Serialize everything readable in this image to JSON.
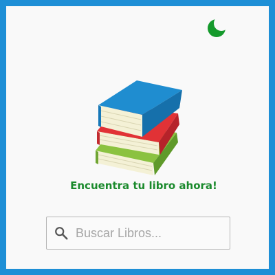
{
  "header": {
    "theme_toggle_icon": "crescent-moon-icon",
    "theme_toggle_color": "#159a2c"
  },
  "hero": {
    "logo_icon": "stacked-books-icon",
    "tagline": "Encuentra tu libro ahora!",
    "tagline_color": "#1a8a2c"
  },
  "search": {
    "icon": "search-icon",
    "placeholder": "Buscar Libros...",
    "value": ""
  },
  "colors": {
    "frame_border": "#1e8fd6",
    "background": "#f9f9f9",
    "book_blue": "#1f8dd0",
    "book_red": "#e13236",
    "book_green": "#8bc240",
    "pages": "#f4f1d6"
  }
}
